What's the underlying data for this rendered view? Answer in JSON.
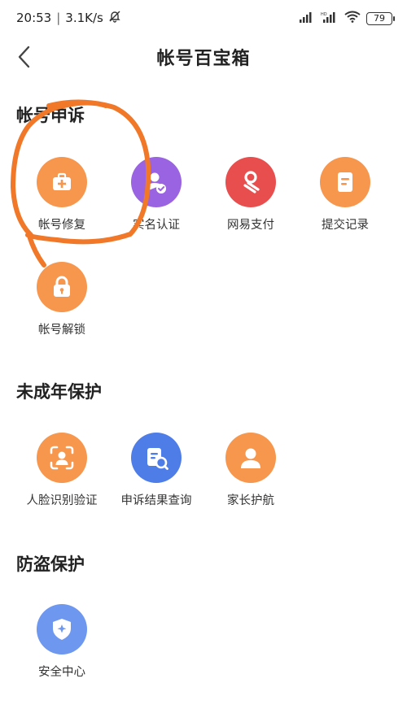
{
  "status": {
    "time": "20:53",
    "speed": "3.1K/s",
    "battery": "79"
  },
  "header": {
    "title": "帐号百宝箱"
  },
  "sections": {
    "appeal": {
      "title": "帐号申诉",
      "items": [
        {
          "label": "帐号修复",
          "icon": "account-repair-icon",
          "color": "#F7964D"
        },
        {
          "label": "实名认证",
          "icon": "real-name-auth-icon",
          "color": "#9A63E2"
        },
        {
          "label": "网易支付",
          "icon": "netease-pay-icon",
          "color": "#E84E4E"
        },
        {
          "label": "提交记录",
          "icon": "submit-record-icon",
          "color": "#F7964D"
        },
        {
          "label": "帐号解锁",
          "icon": "account-unlock-icon",
          "color": "#F7964D"
        }
      ]
    },
    "minor": {
      "title": "未成年保护",
      "items": [
        {
          "label": "人脸识别验证",
          "icon": "face-recognition-icon",
          "color": "#F7964D"
        },
        {
          "label": "申诉结果查询",
          "icon": "appeal-result-query-icon",
          "color": "#4F7DE8"
        },
        {
          "label": "家长护航",
          "icon": "parent-guard-icon",
          "color": "#F7964D"
        }
      ]
    },
    "antitheft": {
      "title": "防盗保护",
      "items": [
        {
          "label": "安全中心",
          "icon": "security-center-icon",
          "color": "#6E97F0"
        }
      ]
    }
  },
  "annotation_color": "#F07828"
}
